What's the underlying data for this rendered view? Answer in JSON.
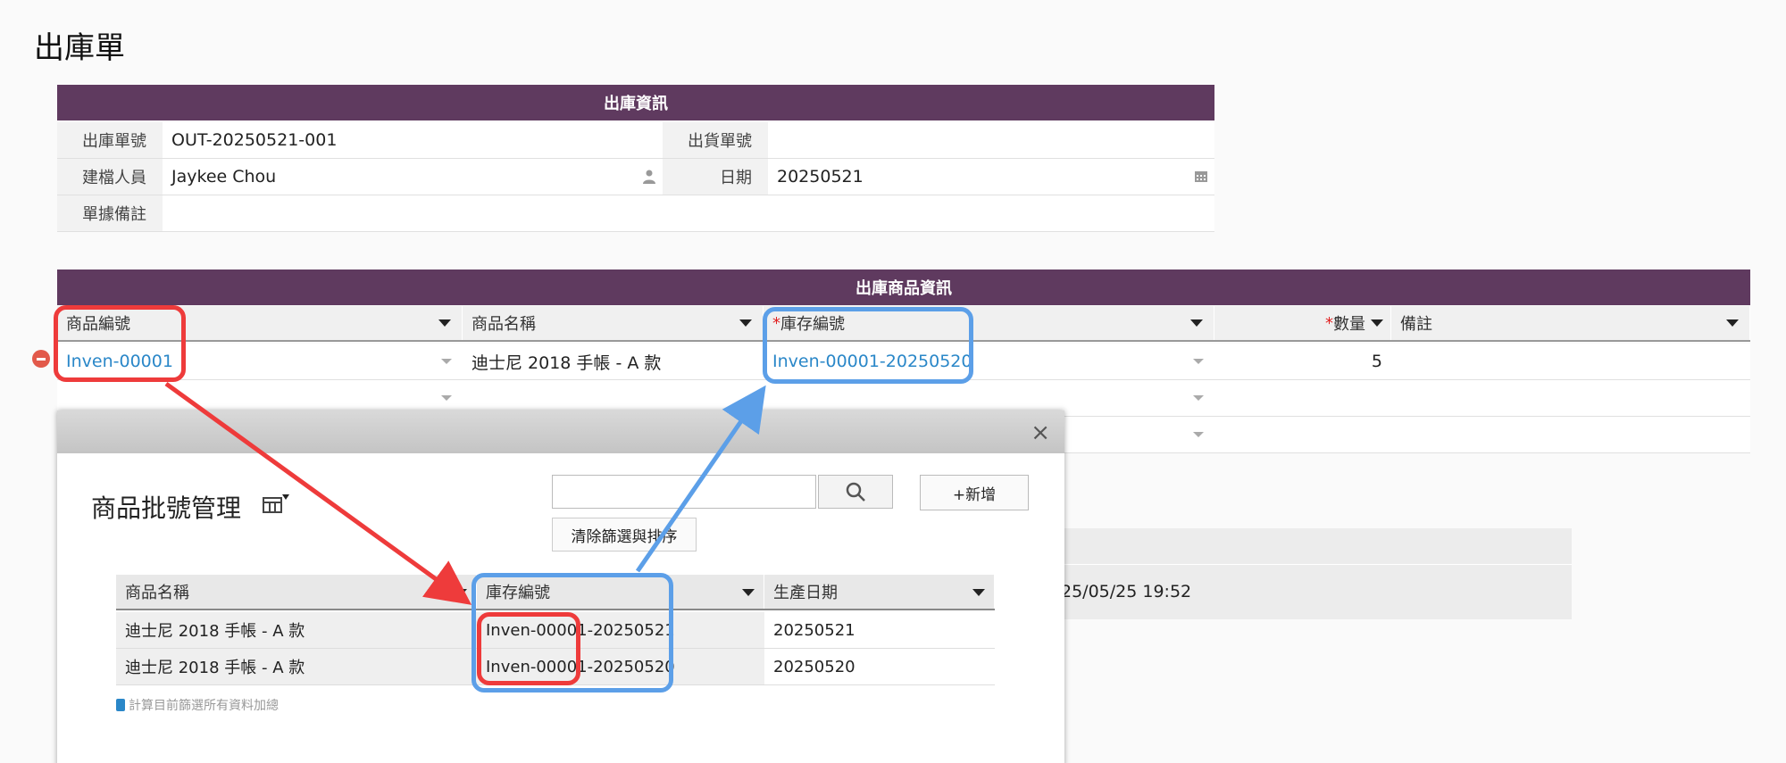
{
  "page": {
    "title": "出庫單"
  },
  "info_section": {
    "header": "出庫資訊",
    "out_no_label": "出庫單號",
    "out_no_value": "OUT-20250521-001",
    "ship_no_label": "出貨單號",
    "ship_no_value": "",
    "creator_label": "建檔人員",
    "creator_value": "Jaykee Chou",
    "date_label": "日期",
    "date_value": "20250521",
    "remark_label": "單據備註",
    "remark_value": ""
  },
  "goods_section": {
    "header": "出庫商品資訊",
    "columns": {
      "item_code": "商品編號",
      "item_name": "商品名稱",
      "stock_code": "庫存編號",
      "quantity": "數量",
      "note": "備註"
    },
    "rows": [
      {
        "item_code": "Inven-00001",
        "item_name": "迪士尼 2018 手帳 - A 款",
        "stock_code": "Inven-00001-20250520",
        "quantity": "5",
        "note": ""
      }
    ]
  },
  "background": {
    "timestamp": "25/05/25 19:52"
  },
  "dialog": {
    "title": "商品批號管理",
    "search_placeholder": "",
    "add_label": "+新增",
    "clear_label": "清除篩選與排序",
    "columns": {
      "name": "商品名稱",
      "stock": "庫存編號",
      "date": "生產日期"
    },
    "rows": [
      {
        "name": "迪士尼 2018 手帳 - A 款",
        "stock_prefix": "Inven-00001",
        "stock_suffix": "-20250521",
        "date": "20250521"
      },
      {
        "name": "迪士尼 2018 手帳 - A 款",
        "stock_prefix": "Inven-00001",
        "stock_suffix": "-20250520",
        "date": "20250520"
      }
    ],
    "footer": "計算目前篩選所有資料加總"
  },
  "colors": {
    "header_bg": "#5f3a5f",
    "link": "#2a87c8",
    "annotation_red": "#ee3b3b",
    "annotation_blue": "#5c9fe8"
  }
}
